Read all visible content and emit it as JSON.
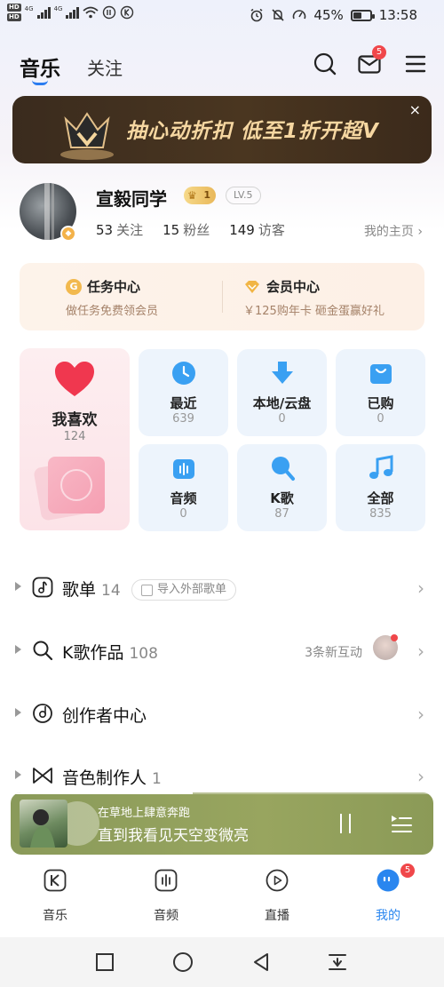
{
  "status_bar": {
    "hd1": "HD",
    "hd2": "HD",
    "net1": "4G",
    "net2": "4G",
    "battery": "45%",
    "time": "13:58"
  },
  "top_nav": {
    "tab_music": "音乐",
    "tab_follow": "关注",
    "mail_badge": "5"
  },
  "banner": {
    "text": "抽心动折扣 低至1折开超V",
    "close": "×"
  },
  "profile": {
    "username": "宣毅同学",
    "vip_level": "1",
    "level": "LV.5",
    "follow_count": "53",
    "follow_label": "关注",
    "fans_count": "15",
    "fans_label": "粉丝",
    "visitor_count": "149",
    "visitor_label": "访客",
    "homepage_link": "我的主页 ›"
  },
  "cards": {
    "task_title": "任务中心",
    "task_sub": "做任务免费领会员",
    "member_title": "会员中心",
    "member_sub": "￥125购年卡 砸金蛋赢好礼"
  },
  "favorites": {
    "label": "我喜欢",
    "count": "124"
  },
  "grid": {
    "recent": {
      "label": "最近",
      "count": "639"
    },
    "local": {
      "label": "本地/云盘",
      "count": "0"
    },
    "purchased": {
      "label": "已购",
      "count": "0"
    },
    "audio": {
      "label": "音频",
      "count": "0"
    },
    "karaoke": {
      "label": "K歌",
      "count": "87"
    },
    "all": {
      "label": "全部",
      "count": "835"
    }
  },
  "list": {
    "playlists": {
      "title": "歌单",
      "count": "14",
      "import_label": "导入外部歌单"
    },
    "karaoke_works": {
      "title": "K歌作品",
      "count": "108",
      "interaction": "3条新互动"
    },
    "creator": {
      "title": "创作者中心"
    },
    "voice_maker": {
      "title": "音色制作人",
      "count": "1"
    }
  },
  "player": {
    "subtitle": "在草地上肆意奔跑",
    "title": "直到我看见天空变微亮",
    "progress": 0.43
  },
  "bottom_nav": {
    "music": "音乐",
    "audio": "音频",
    "live": "直播",
    "mine": "我的",
    "mine_badge": "5"
  },
  "colors": {
    "accent": "#2a86ef",
    "badge": "#f0474a",
    "banner_gold": "#f6d7a1",
    "player_bg": "#95a35d"
  }
}
